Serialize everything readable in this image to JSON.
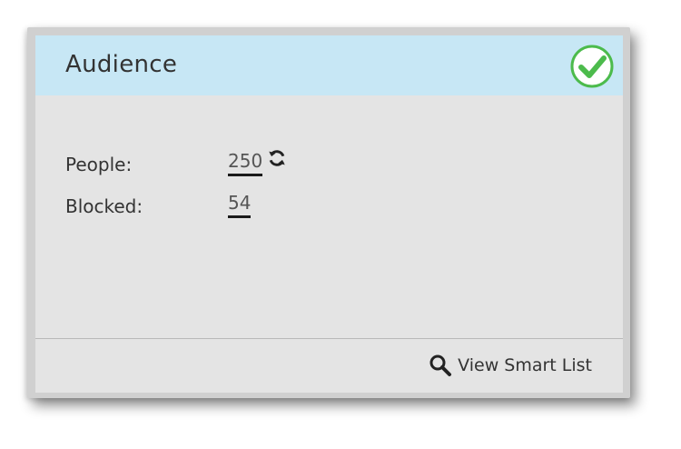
{
  "card": {
    "title": "Audience",
    "status_icon": "check-circle-icon",
    "status_color": "#4cbb4c"
  },
  "fields": {
    "people": {
      "label": "People:",
      "value": "250",
      "refresh_icon": "refresh-icon"
    },
    "blocked": {
      "label": "Blocked:",
      "value": "54"
    }
  },
  "footer": {
    "action_icon": "search-icon",
    "action_label": "View Smart List"
  },
  "colors": {
    "header_bg": "#c7e7f5",
    "card_bg": "#e4e4e4",
    "text": "#333333"
  }
}
